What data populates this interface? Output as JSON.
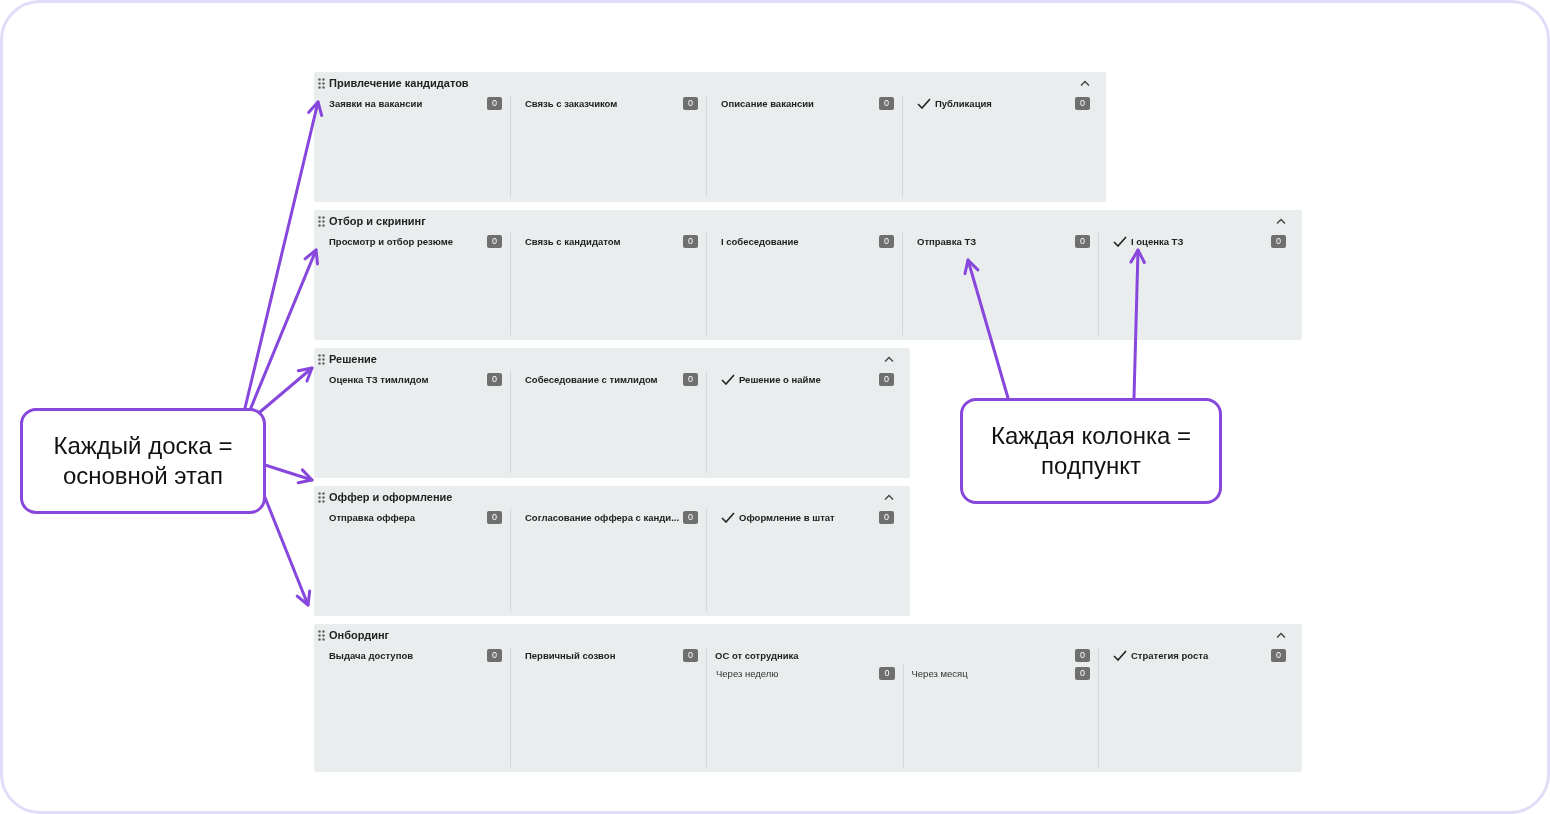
{
  "boards": [
    {
      "title": "Привлечение кандидатов",
      "columns": [
        {
          "kind": "column",
          "title": "Заявки на вакансии",
          "count": "0",
          "done": false
        },
        {
          "kind": "column",
          "title": "Связь с заказчиком",
          "count": "0",
          "done": false
        },
        {
          "kind": "column",
          "title": "Описание вакансии",
          "count": "0",
          "done": false
        },
        {
          "kind": "column",
          "title": "Публикация",
          "count": "0",
          "done": true
        }
      ]
    },
    {
      "title": "Отбор и скрининг",
      "columns": [
        {
          "kind": "column",
          "title": "Просмотр и отбор резюме",
          "count": "0",
          "done": false
        },
        {
          "kind": "column",
          "title": "Связь с кандидатом",
          "count": "0",
          "done": false
        },
        {
          "kind": "column",
          "title": "I собеседование",
          "count": "0",
          "done": false
        },
        {
          "kind": "column",
          "title": "Отправка ТЗ",
          "count": "0",
          "done": false
        },
        {
          "kind": "column",
          "title": "I оценка ТЗ",
          "count": "0",
          "done": true
        }
      ]
    },
    {
      "title": "Решение",
      "columns": [
        {
          "kind": "column",
          "title": "Оценка ТЗ тимлидом",
          "count": "0",
          "done": false
        },
        {
          "kind": "column",
          "title": "Собеседование с тимлидом",
          "count": "0",
          "done": false
        },
        {
          "kind": "column",
          "title": "Решение о найме",
          "count": "0",
          "done": true
        }
      ]
    },
    {
      "title": "Оффер и оформление",
      "columns": [
        {
          "kind": "column",
          "title": "Отправка оффера",
          "count": "0",
          "done": false
        },
        {
          "kind": "column",
          "title": "Согласование оффера с канди...",
          "count": "0",
          "done": false
        },
        {
          "kind": "column",
          "title": "Оформление в штат",
          "count": "0",
          "done": true
        }
      ]
    },
    {
      "title": "Онбординг",
      "columns": [
        {
          "kind": "column",
          "title": "Выдача доступов",
          "count": "0",
          "done": false
        },
        {
          "kind": "column",
          "title": "Первичный созвон",
          "count": "0",
          "done": false
        },
        {
          "kind": "group",
          "title": "ОС от сотрудника",
          "count": "0",
          "done": false,
          "subcolumns": [
            {
              "title": "Через неделю",
              "count": "0"
            },
            {
              "title": "Через месяц",
              "count": "0"
            }
          ]
        },
        {
          "kind": "column",
          "title": "Стратегия роста",
          "count": "0",
          "done": true
        }
      ]
    }
  ],
  "callouts": [
    {
      "text": "Каждый доска = основной этап"
    },
    {
      "text": "Каждая колонка = подпункт"
    }
  ]
}
